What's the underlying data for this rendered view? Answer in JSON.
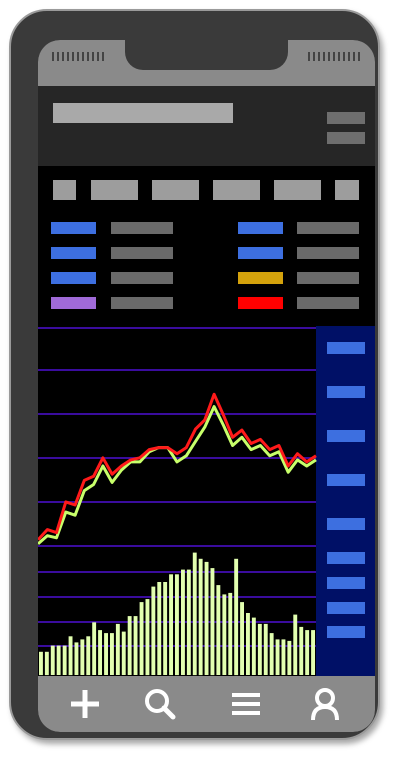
{
  "colors": {
    "screen": "#000000",
    "header": "#262626",
    "chrome": "#8a8a8a",
    "panel_right": "#001066",
    "grid": "#3a0c9e",
    "price_a": "#ff1a1a",
    "price_b": "#c8ff6a",
    "volume": "#e2ffb0",
    "tag": "#3d6fe0"
  },
  "legend": {
    "left": [
      {
        "color": "#3d6fe0"
      },
      {
        "color": "#3d6fe0"
      },
      {
        "color": "#3d6fe0"
      },
      {
        "color": "#a06ad8"
      }
    ],
    "right": [
      {
        "color": "#3d6fe0"
      },
      {
        "color": "#3d6fe0"
      },
      {
        "color": "#d4a20c"
      },
      {
        "color": "#ff0000"
      }
    ]
  },
  "footer": {
    "icons": [
      "plus-icon",
      "search-icon",
      "menu-icon",
      "user-icon"
    ]
  },
  "chart_data": {
    "type": "line",
    "series": [
      {
        "values": [
          0.08,
          0.18,
          0.15,
          0.45,
          0.42,
          0.66,
          0.7,
          0.88,
          0.72,
          0.8,
          0.86,
          0.88,
          0.96,
          0.98,
          0.98,
          0.92,
          0.98,
          1.16,
          1.25,
          1.5,
          1.3,
          1.08,
          1.15,
          1.02,
          1.06,
          0.96,
          1.0,
          0.8,
          0.92,
          0.84,
          0.9
        ]
      },
      {
        "values": [
          0.04,
          0.12,
          0.1,
          0.35,
          0.32,
          0.56,
          0.62,
          0.8,
          0.64,
          0.76,
          0.84,
          0.84,
          0.94,
          0.98,
          0.98,
          0.84,
          0.9,
          1.04,
          1.18,
          1.38,
          1.2,
          1.0,
          1.08,
          0.96,
          1.0,
          0.9,
          0.94,
          0.74,
          0.86,
          0.8,
          0.86
        ]
      }
    ],
    "volume": [
      30,
      30,
      38,
      38,
      38,
      50,
      42,
      46,
      50,
      68,
      58,
      54,
      54,
      66,
      56,
      76,
      76,
      94,
      98,
      114,
      120,
      120,
      130,
      130,
      136,
      136,
      158,
      150,
      146,
      138,
      116,
      104,
      106,
      150,
      94,
      80,
      74,
      66,
      66,
      54,
      46,
      46,
      44,
      78,
      62,
      58,
      58
    ]
  }
}
